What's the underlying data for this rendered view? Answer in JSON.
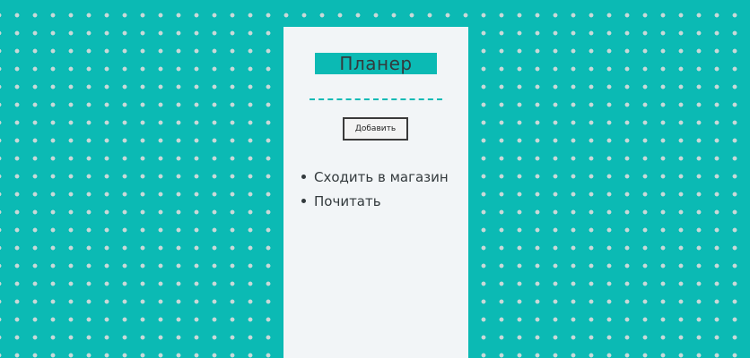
{
  "planner": {
    "title": "Планер",
    "add_button_label": "Добавить",
    "tasks": [
      {
        "text": "Сходить в магазин"
      },
      {
        "text": "Почитать"
      }
    ]
  },
  "colors": {
    "background": "#0bbab4",
    "dots": "#c9d9d8",
    "panel": "#f2f5f7",
    "text": "#333a3d"
  }
}
